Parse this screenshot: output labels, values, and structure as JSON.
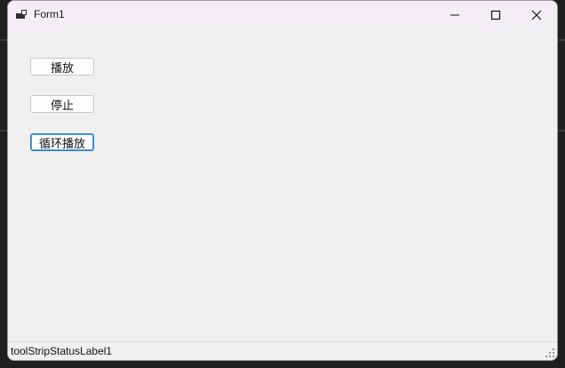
{
  "window": {
    "title": "Form1"
  },
  "buttons": {
    "play": "播放",
    "stop": "停止",
    "loop_play": "循环播放"
  },
  "status_bar": {
    "label": "toolStripStatusLabel1"
  },
  "icons": {
    "app": "app-window-icon",
    "minimize": "minimize-icon",
    "maximize": "maximize-icon",
    "close": "close-icon",
    "resize_grip": "resize-grip-icon"
  },
  "colors": {
    "titlebar": "#f3eef4",
    "client": "#f0f0f0",
    "focus_border": "#2f78c4",
    "background_editor": "#1f1f1f"
  }
}
